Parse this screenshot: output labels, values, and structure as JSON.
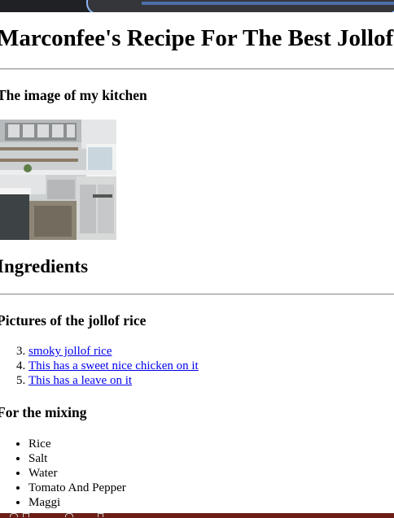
{
  "page": {
    "title": "Marconfee's Recipe For The Best Jollof",
    "kitchen_heading": "The image of my kitchen",
    "ingredients_heading": "Ingredients",
    "pictures_heading": "Pictures of the jollof rice",
    "mixing_heading": "For the mixing"
  },
  "picture_links": [
    {
      "label": "smoky jollof rice"
    },
    {
      "label": "This has a sweet nice chicken on it"
    },
    {
      "label": "This has a leave on it"
    }
  ],
  "mixing_items": [
    "Rice",
    "Salt",
    "Water",
    "Tomato And Pepper",
    "Maggi"
  ],
  "colors": {
    "link": "#0000ee",
    "chrome": "#202124",
    "url_focus": "#8ab4f8",
    "taskbar": "#6b1d16"
  }
}
